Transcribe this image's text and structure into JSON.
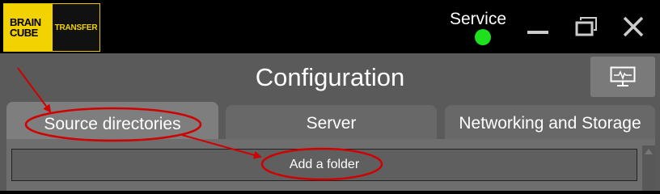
{
  "logo": {
    "left_line1": "BRAIN",
    "left_line2": "CUBE",
    "right": "TRANSFER"
  },
  "header": {
    "service_label": "Service",
    "service_status_color": "#1ee01e"
  },
  "window_controls": {
    "icons": [
      "minimize-icon",
      "maximize-icon",
      "close-icon"
    ]
  },
  "main": {
    "title": "Configuration",
    "monitor_icon": "monitor-icon",
    "tabs": [
      {
        "label": "Source directories",
        "active": true
      },
      {
        "label": "Server",
        "active": false
      },
      {
        "label": "Networking and Storage",
        "active": false
      }
    ],
    "add_folder_label": "Add a folder"
  },
  "annotation_color": "#d00000"
}
